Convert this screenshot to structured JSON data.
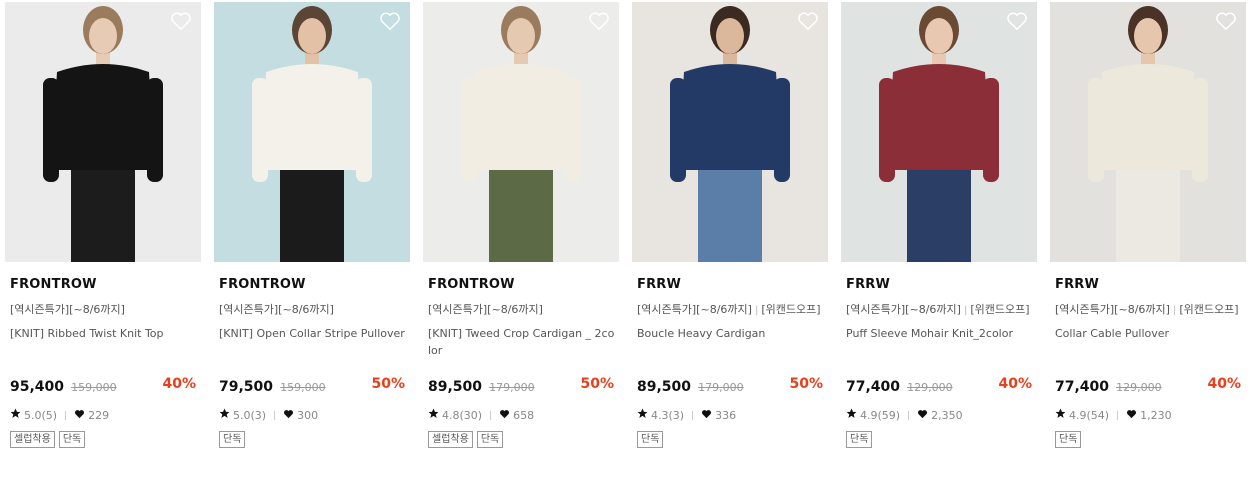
{
  "products": [
    {
      "brand": "FRONTROW",
      "promo": "[역시즌특가][~8/6까지]",
      "extra": "",
      "name": "[KNIT] Ribbed Twist Knit Top",
      "price": "95,400",
      "original": "159,000",
      "discount": "40%",
      "rating": "5.0(5)",
      "likes": "229",
      "tags": [
        "셀럽착용",
        "단독"
      ],
      "colors": {
        "bg": "#ebebeb",
        "top": "#141414",
        "bottom": "#1c1c1c",
        "skin": "#e7cbb4",
        "hair": "#9a7b5d"
      }
    },
    {
      "brand": "FRONTROW",
      "promo": "[역시즌특가][~8/6까지]",
      "extra": "",
      "name": "[KNIT] Open Collar Stripe Pullover",
      "price": "79,500",
      "original": "159,000",
      "discount": "50%",
      "rating": "5.0(3)",
      "likes": "300",
      "tags": [
        "단독"
      ],
      "colors": {
        "bg": "#c3dde0",
        "top": "#f3f1ea",
        "bottom": "#1b1b1b",
        "skin": "#e2c1a6",
        "hair": "#5b4534"
      }
    },
    {
      "brand": "FRONTROW",
      "promo": "[역시즌특가][~8/6까지]",
      "extra": "",
      "name": "[KNIT] Tweed Crop Cardigan _ 2color",
      "price": "89,500",
      "original": "179,000",
      "discount": "50%",
      "rating": "4.8(30)",
      "likes": "658",
      "tags": [
        "셀럽착용",
        "단독"
      ],
      "colors": {
        "bg": "#ececea",
        "top": "#f1ede3",
        "bottom": "#5c6b46",
        "skin": "#e6c9b1",
        "hair": "#9a7b5d"
      }
    },
    {
      "brand": "FRRW",
      "promo": "[역시즌특가][~8/6까지]",
      "extra": "[위캔드오프]",
      "name": "Boucle Heavy Cardigan",
      "price": "89,500",
      "original": "179,000",
      "discount": "50%",
      "rating": "4.3(3)",
      "likes": "336",
      "tags": [
        "단독"
      ],
      "colors": {
        "bg": "#e8e4df",
        "top": "#243a66",
        "bottom": "#5a7ea8",
        "skin": "#dbb79b",
        "hair": "#3b2a20"
      }
    },
    {
      "brand": "FRRW",
      "promo": "[역시즌특가][~8/6까지]",
      "extra": "[위캔드오프]",
      "name": "Puff Sleeve Mohair Knit_2color",
      "price": "77,400",
      "original": "129,000",
      "discount": "40%",
      "rating": "4.9(59)",
      "likes": "2,350",
      "tags": [
        "단독"
      ],
      "colors": {
        "bg": "#dfe3e2",
        "top": "#8c2e38",
        "bottom": "#2b3f66",
        "skin": "#e9c8b2",
        "hair": "#6b4a34"
      }
    },
    {
      "brand": "FRRW",
      "promo": "[역시즌특가][~8/6까지]",
      "extra": "[위캔드오프]",
      "name": "Collar Cable Pullover",
      "price": "77,400",
      "original": "129,000",
      "discount": "40%",
      "rating": "4.9(54)",
      "likes": "1,230",
      "tags": [
        "단독"
      ],
      "colors": {
        "bg": "#e3e1de",
        "top": "#ede8dc",
        "bottom": "#ece9e2",
        "skin": "#e6c7ae",
        "hair": "#4a3326"
      }
    }
  ],
  "icons": {
    "wishlist": "heart-outline-icon",
    "rating": "star-icon",
    "likes": "heart-filled-icon"
  },
  "accent": "#e8401c"
}
